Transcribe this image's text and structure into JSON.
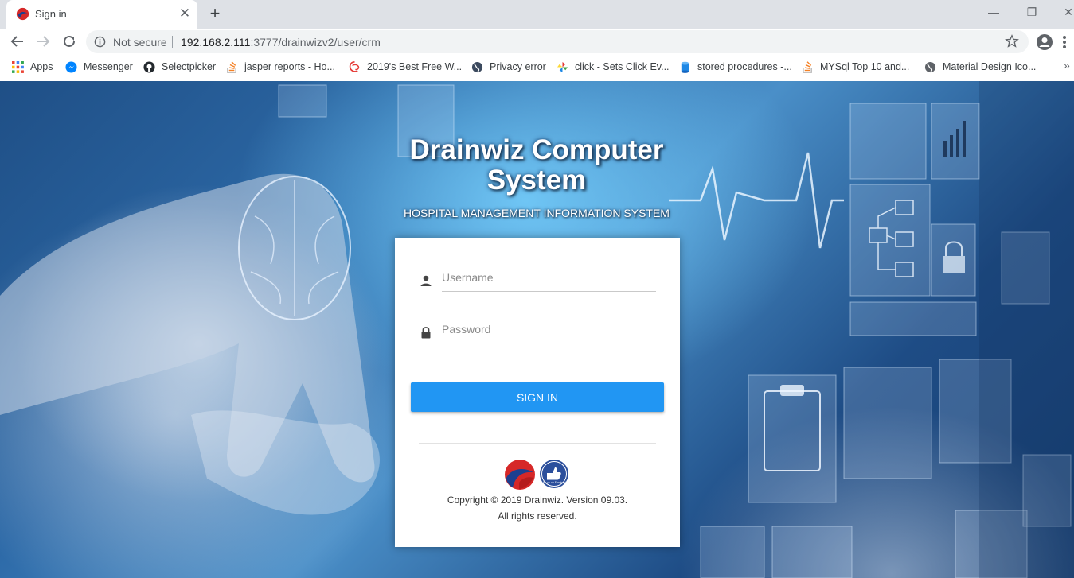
{
  "browser": {
    "tab": {
      "title": "Sign in"
    },
    "address": {
      "security_label": "Not secure",
      "host": "192.168.2.111",
      "path": ":3777/drainwizv2/user/crm"
    },
    "bookmarks": [
      {
        "label": "Apps",
        "icon": "apps-grid-icon"
      },
      {
        "label": "Messenger",
        "icon": "messenger-icon"
      },
      {
        "label": "Selectpicker",
        "icon": "github-icon"
      },
      {
        "label": "jasper reports - Ho...",
        "icon": "stackoverflow-icon"
      },
      {
        "label": "2019's Best Free W...",
        "icon": "site-icon"
      },
      {
        "label": "Privacy error",
        "icon": "globe-icon"
      },
      {
        "label": "click - Sets Click Ev...",
        "icon": "pinwheel-icon"
      },
      {
        "label": "stored procedures -...",
        "icon": "database-icon"
      },
      {
        "label": "MYSql Top 10 and...",
        "icon": "stackoverflow-icon"
      },
      {
        "label": "Material Design Ico...",
        "icon": "globe-icon"
      }
    ],
    "more_bookmarks": "»"
  },
  "hero": {
    "title": "Drainwiz Computer System",
    "subtitle": "HOSPITAL MANAGEMENT INFORMATION SYSTEM"
  },
  "login": {
    "username_placeholder": "Username",
    "password_placeholder": "Password",
    "signin_label": "SIGN IN",
    "facebook_badge": "Like us on Facebook",
    "copyright": "Copyright © 2019 Drainwiz. Version 09.03.",
    "rights": "All rights reserved."
  },
  "colors": {
    "accent": "#2196f3",
    "tab_strip": "#dee1e6",
    "omnibox": "#f1f3f4"
  }
}
